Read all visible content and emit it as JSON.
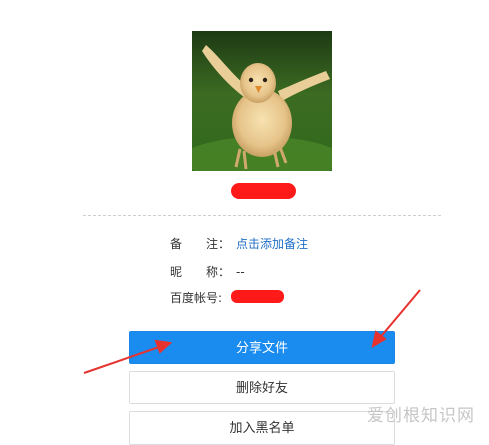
{
  "profile": {
    "avatar_icon": "chick-photo",
    "name_redacted": true
  },
  "info": {
    "remark_label": "备注：",
    "remark_label_chars": [
      "备",
      "注："
    ],
    "remark_value": "点击添加备注",
    "nickname_label_chars": [
      "昵",
      "称："
    ],
    "nickname_value": "--",
    "account_label": "百度帐号:",
    "account_redacted": true
  },
  "actions": {
    "share_label": "分享文件",
    "delete_label": "删除好友",
    "block_label": "加入黑名单"
  },
  "watermark": {
    "text": "爱创根知识网"
  },
  "colors": {
    "primary": "#1a8cf0",
    "link": "#1f6fc6",
    "redaction": "#ff1a1a",
    "annotation_arrow": "#e8322e"
  }
}
